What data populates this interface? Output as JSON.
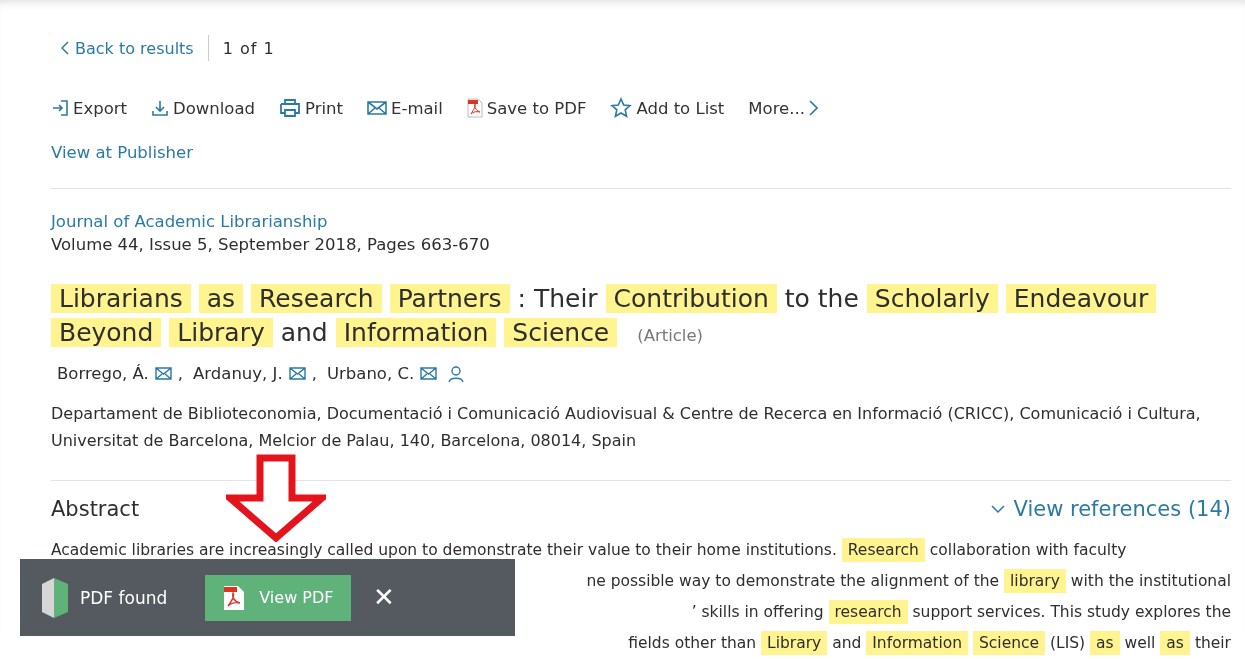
{
  "nav": {
    "back": "Back to results",
    "position": "1 of 1"
  },
  "actions": [
    {
      "label": "Export",
      "kind": "export"
    },
    {
      "label": "Download",
      "kind": "download"
    },
    {
      "label": "Print",
      "kind": "print"
    },
    {
      "label": "E-mail",
      "kind": "email"
    },
    {
      "label": "Save to PDF",
      "kind": "pdf"
    },
    {
      "label": "Add to List",
      "kind": "star"
    },
    {
      "label": "More...",
      "kind": "more"
    }
  ],
  "view_at_publisher": "View at Publisher",
  "journal": "Journal of Academic Librarianship",
  "volume": "Volume 44, Issue 5, September 2018, Pages 663-670",
  "title": [
    {
      "text": "Librarians",
      "highlight": true
    },
    {
      "text": "as",
      "highlight": true
    },
    {
      "text": "Research",
      "highlight": true
    },
    {
      "text": "Partners",
      "highlight": true
    },
    {
      "text": ": Their",
      "highlight": false
    },
    {
      "text": "Contribution",
      "highlight": true
    },
    {
      "text": "to the",
      "highlight": false
    },
    {
      "text": "Scholarly",
      "highlight": true
    },
    {
      "text": "Endeavour",
      "highlight": true
    },
    {
      "text": "Beyond",
      "highlight": true
    },
    {
      "text": "Library",
      "highlight": true
    },
    {
      "text": "and",
      "highlight": false
    },
    {
      "text": "Information",
      "highlight": true
    },
    {
      "text": "Science",
      "highlight": true
    }
  ],
  "doc_type": "(Article)",
  "authors": [
    {
      "name": "Borrego, Á.",
      "email": true,
      "separator": ","
    },
    {
      "name": "Ardanuy, J.",
      "email": true,
      "separator": ","
    },
    {
      "name": "Urbano, C.",
      "email": true
    }
  ],
  "affiliation": "Departament de Biblioteconomia, Documentació i Comunicació Audiovisual & Centre de Recerca en Informació (CRICC), Comunicació i Cultura, Universitat de Barcelona, Melcior de Palau, 140, Barcelona, 08014, Spain",
  "abstract": {
    "heading": "Abstract",
    "view_references": "View references (14)",
    "lines": [
      [
        {
          "text": "Academic libraries are increasingly called upon to demonstrate their value to their home institutions.",
          "highlight": false
        },
        {
          "text": "Research",
          "highlight": true
        },
        {
          "text": "collaboration with faculty",
          "highlight": false
        }
      ],
      [
        {
          "text": "ne possible way to demonstrate the alignment of the",
          "highlight": false
        },
        {
          "text": "library",
          "highlight": true
        },
        {
          "text": "with the institutional",
          "highlight": false
        }
      ],
      [
        {
          "text": "’ skills in offering",
          "highlight": false
        },
        {
          "text": "research",
          "highlight": true
        },
        {
          "text": "support services. This study explores the",
          "highlight": false
        }
      ],
      [
        {
          "text": "fields other than",
          "highlight": false
        },
        {
          "text": "Library",
          "highlight": true
        },
        {
          "text": "and",
          "highlight": false
        },
        {
          "text": "Information",
          "highlight": true
        },
        {
          "text": "Science",
          "highlight": true
        },
        {
          "text": "(LIS)",
          "highlight": false
        },
        {
          "text": "as",
          "highlight": true
        },
        {
          "text": "well",
          "highlight": false
        },
        {
          "text": "as",
          "highlight": true
        },
        {
          "text": "their",
          "highlight": false
        }
      ]
    ]
  },
  "toast": {
    "message": "PDF found",
    "button": "View PDF",
    "close": "✕"
  }
}
